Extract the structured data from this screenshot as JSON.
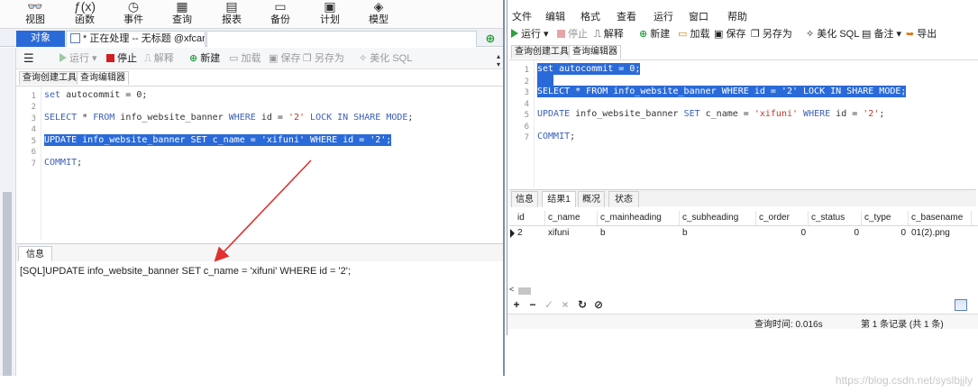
{
  "left": {
    "toolbar": [
      {
        "label": "视图",
        "icon": "glasses-icon",
        "glyph": "👓"
      },
      {
        "label": "函数",
        "icon": "function-icon",
        "glyph": "ƒ(x)"
      },
      {
        "label": "事件",
        "icon": "clock-icon",
        "glyph": "◷"
      },
      {
        "label": "查询",
        "icon": "query-grid-icon",
        "glyph": "▦"
      },
      {
        "label": "报表",
        "icon": "report-icon",
        "glyph": "▤"
      },
      {
        "label": "备份",
        "icon": "backup-icon",
        "glyph": "▭"
      },
      {
        "label": "计划",
        "icon": "calendar-icon",
        "glyph": "▣"
      },
      {
        "label": "模型",
        "icon": "model-icon",
        "glyph": "◈"
      }
    ],
    "tabs": {
      "object": "对象",
      "document": "* 正在处理 -- 无标题 @xfcam..."
    },
    "query_toolbar": {
      "run": "运行",
      "stop": "停止",
      "explain": "解释",
      "new": "新建",
      "load": "加载",
      "save": "保存",
      "save_as": "另存为",
      "beautify": "美化 SQL"
    },
    "editor_tabs": [
      "查询创建工具",
      "查询编辑器"
    ],
    "line_numbers": [
      "1",
      "2",
      "3",
      "4",
      "5",
      "6",
      "7"
    ],
    "code": {
      "l1_kw": "set",
      "l1_rest": " autocommit = 0;",
      "l3_kw1": "SELECT",
      "l3_a": " * ",
      "l3_kw2": "FROM",
      "l3_b": " info_website_banner ",
      "l3_kw3": "WHERE",
      "l3_c": " id = ",
      "l3_str": "'2'",
      "l3_d": " ",
      "l3_kw4": "LOCK IN SHARE MODE",
      "l3_e": ";",
      "l5_full": "UPDATE info_website_banner SET c_name = 'xifuni' WHERE id = '2';",
      "l7_kw": "COMMIT",
      "l7_rest": ";"
    },
    "info_tab": "信息",
    "info_message": "[SQL]UPDATE info_website_banner SET c_name = 'xifuni' WHERE id = '2';",
    "colors": {
      "accent": "#2a6ad8",
      "arrow": "#e03030"
    }
  },
  "right": {
    "menu": [
      "文件",
      "编辑",
      "格式",
      "查看",
      "运行",
      "窗口",
      "帮助"
    ],
    "toolbar": {
      "run": "运行",
      "stop": "停止",
      "explain": "解释",
      "new": "新建",
      "load": "加载",
      "save": "保存",
      "save_as": "另存为",
      "beautify": "美化 SQL",
      "note": "备注",
      "export": "导出"
    },
    "editor_tabs": [
      "查询创建工具",
      "查询编辑器"
    ],
    "line_numbers": [
      "1",
      "2",
      "3",
      "4",
      "5",
      "6",
      "7"
    ],
    "code": {
      "l1_full": "set autocommit = 0;",
      "l3_full": "SELECT * FROM info_website_banner WHERE id = '2' LOCK IN SHARE MODE;",
      "l5_kw1": "UPDATE",
      "l5_a": " info_website_banner ",
      "l5_kw2": "SET",
      "l5_b": " c_name = ",
      "l5_str1": "'xifuni'",
      "l5_c": " ",
      "l5_kw3": "WHERE",
      "l5_d": " id = ",
      "l5_str2": "'2'",
      "l5_e": ";",
      "l7_kw": "COMMIT",
      "l7_rest": ";"
    },
    "result_tabs": [
      "信息",
      "结果1",
      "概况",
      "状态"
    ],
    "table": {
      "headers": [
        "id",
        "c_name",
        "c_mainheading",
        "c_subheading",
        "c_order",
        "c_status",
        "c_type",
        "c_basename"
      ],
      "row": [
        "2",
        "xifuni",
        "b",
        "b",
        "0",
        "0",
        "0",
        "01(2).png"
      ]
    },
    "status": {
      "query_time": "查询时间: 0.016s",
      "records": "第 1 条记录 (共 1 条)"
    }
  },
  "watermark": "https://blog.csdn.net/syslbjjly"
}
